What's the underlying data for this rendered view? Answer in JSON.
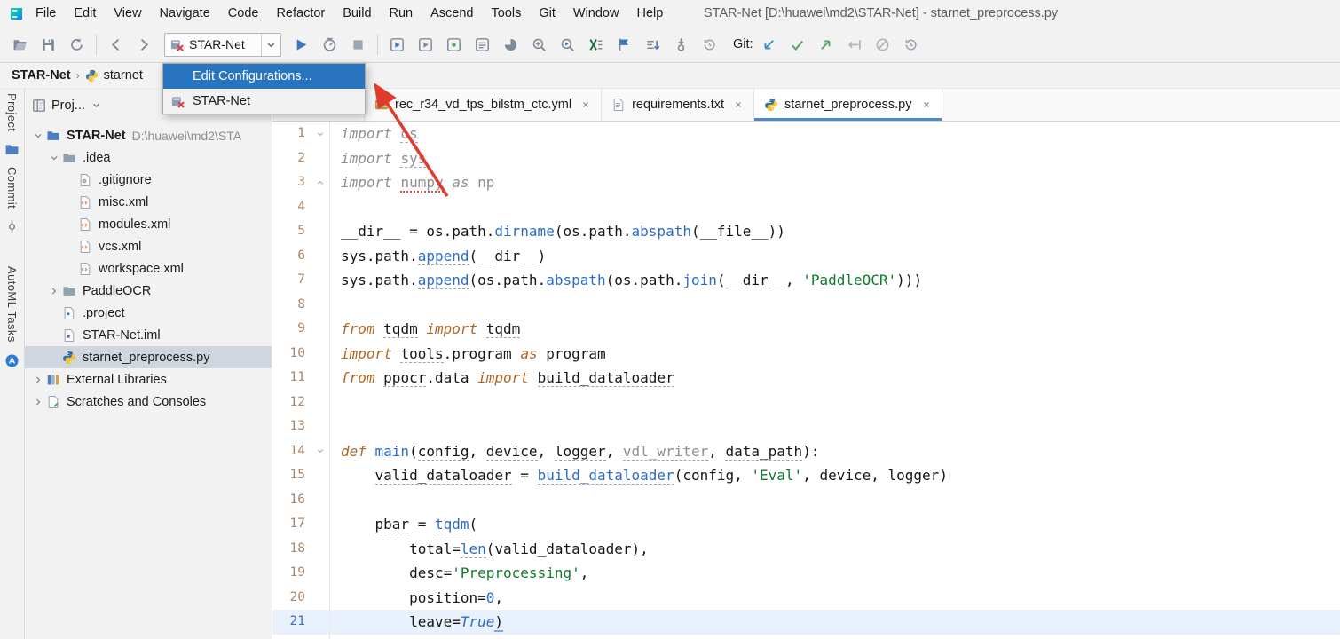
{
  "window": {
    "title": "STAR-Net [D:\\huawei\\md2\\STAR-Net] - starnet_preprocess.py",
    "app_icon": "app-logo"
  },
  "menu": {
    "items": [
      "File",
      "Edit",
      "View",
      "Navigate",
      "Code",
      "Refactor",
      "Build",
      "Run",
      "Ascend",
      "Tools",
      "Git",
      "Window",
      "Help"
    ]
  },
  "toolbar": {
    "file_icons": [
      {
        "name": "open-icon",
        "icon": "folder-open"
      },
      {
        "name": "save-all-icon",
        "icon": "save"
      },
      {
        "name": "sync-icon",
        "icon": "sync"
      }
    ],
    "nav_icons": [
      {
        "name": "back-icon",
        "icon": "back"
      },
      {
        "name": "forward-icon",
        "icon": "forward"
      }
    ],
    "run_config": {
      "label": "STAR-Net",
      "icon": "run-config-broken",
      "chevron": "chev-down"
    },
    "run_icons": [
      {
        "name": "run-button",
        "icon": "play"
      },
      {
        "name": "profiler-button",
        "icon": "profiler"
      },
      {
        "name": "stop-button",
        "icon": "stop"
      }
    ],
    "tool_icons": [
      {
        "name": "run-dashboard-icon",
        "icon": "sq-play"
      },
      {
        "name": "debug-dashboard-icon",
        "icon": "sq-play-gray"
      },
      {
        "name": "services-icon",
        "icon": "sq-dot"
      },
      {
        "name": "console-icon",
        "icon": "sq-lines"
      },
      {
        "name": "coverage-icon",
        "icon": "pie"
      },
      {
        "name": "inspect-code-icon",
        "icon": "search-plus"
      },
      {
        "name": "run-inspection-icon",
        "icon": "search-play"
      },
      {
        "name": "excel-export-icon",
        "icon": "excel"
      },
      {
        "name": "bookmark-icon",
        "icon": "flag"
      },
      {
        "name": "sort-lines-icon",
        "icon": "sort-lines"
      },
      {
        "name": "fetch-icon",
        "icon": "commit-down"
      },
      {
        "name": "local-history-icon",
        "icon": "history"
      }
    ],
    "git_label": "Git:",
    "git_icons": [
      {
        "name": "git-update-icon",
        "icon": "git-update"
      },
      {
        "name": "git-commit-icon",
        "icon": "git-check"
      },
      {
        "name": "git-push-icon",
        "icon": "git-push"
      },
      {
        "name": "git-revert-icon",
        "icon": "git-revert"
      },
      {
        "name": "git-stash-icon",
        "icon": "slash-circle"
      },
      {
        "name": "git-history-icon",
        "icon": "history"
      }
    ]
  },
  "breadcrumb": {
    "items": [
      {
        "label": "STAR-Net",
        "icon": null
      },
      {
        "label": "starnet",
        "icon": "python"
      }
    ]
  },
  "config_menu": {
    "items": [
      {
        "label": "Edit Configurations...",
        "selected": true,
        "icon": null
      },
      {
        "label": "STAR-Net",
        "selected": false,
        "icon": "run-config-broken"
      }
    ]
  },
  "stripe": {
    "items": [
      {
        "type": "label",
        "text": "Project",
        "name": "tool-button-project"
      },
      {
        "type": "icon",
        "icon": "folder-blue",
        "name": "project-tool-icon"
      },
      {
        "type": "label",
        "text": "Commit",
        "name": "tool-button-commit"
      },
      {
        "type": "icon",
        "icon": "stripe-commit",
        "name": "commit-tool-icon"
      },
      {
        "type": "gap",
        "size": 14
      },
      {
        "type": "label",
        "text": "AutoML Tasks",
        "name": "tool-button-automl-tasks"
      },
      {
        "type": "icon",
        "icon": "automl",
        "name": "automl-tool-icon"
      }
    ]
  },
  "project_panel": {
    "title": "Proj...",
    "header_icons": [
      {
        "name": "locate-file-icon",
        "icon": "target"
      },
      {
        "name": "settings-icon",
        "icon": "gear"
      }
    ],
    "tree": [
      {
        "label": "STAR-Net",
        "sublabel": "D:\\huawei\\md2\\STA",
        "depth": 0,
        "icon": "folder-blue",
        "chevron": "open",
        "bold": true
      },
      {
        "label": ".idea",
        "depth": 1,
        "icon": "folder",
        "chevron": "open"
      },
      {
        "label": ".gitignore",
        "depth": 2,
        "icon": "file-ignore"
      },
      {
        "label": "misc.xml",
        "depth": 2,
        "icon": "file-xml"
      },
      {
        "label": "modules.xml",
        "depth": 2,
        "icon": "file-xml"
      },
      {
        "label": "vcs.xml",
        "depth": 2,
        "icon": "file-xml"
      },
      {
        "label": "workspace.xml",
        "depth": 2,
        "icon": "file-xml"
      },
      {
        "label": "PaddleOCR",
        "depth": 1,
        "icon": "folder",
        "chevron": "closed"
      },
      {
        "label": ".project",
        "depth": 1,
        "icon": "file-project"
      },
      {
        "label": "STAR-Net.iml",
        "depth": 1,
        "icon": "file-iml"
      },
      {
        "label": "starnet_preprocess.py",
        "depth": 1,
        "icon": "python",
        "selected": true
      },
      {
        "label": "External Libraries",
        "depth": 0,
        "icon": "libraries",
        "chevron": "closed"
      },
      {
        "label": "Scratches and Consoles",
        "depth": 0,
        "icon": "scratches",
        "chevron": "closed"
      }
    ]
  },
  "tabs": [
    {
      "label": "",
      "icon": null,
      "stub": true
    },
    {
      "label": "rec_r34_vd_tps_bilstm_ctc.yml",
      "icon": "yml"
    },
    {
      "label": "requirements.txt",
      "icon": "file-text"
    },
    {
      "label": "starnet_preprocess.py",
      "icon": "python",
      "active": true
    }
  ],
  "editor": {
    "current_line": 21,
    "lines": [
      {
        "n": 1,
        "fold": "down",
        "segs": [
          {
            "t": "import ",
            "c": "gkw"
          },
          {
            "t": "os",
            "c": "gray",
            "u": "dash"
          }
        ]
      },
      {
        "n": 2,
        "segs": [
          {
            "t": "import ",
            "c": "gkw"
          },
          {
            "t": "sys",
            "c": "gray",
            "u": "dash"
          }
        ]
      },
      {
        "n": 3,
        "fold": "up",
        "segs": [
          {
            "t": "import ",
            "c": "gkw"
          },
          {
            "t": "numpy",
            "c": "gray",
            "u": "red"
          },
          {
            "t": " ",
            "c": "gray"
          },
          {
            "t": "as",
            "c": "gkw"
          },
          {
            "t": " np",
            "c": "gray"
          }
        ]
      },
      {
        "n": 4,
        "segs": []
      },
      {
        "n": 5,
        "segs": [
          {
            "t": "__dir__ = os.path.",
            "c": "plain"
          },
          {
            "t": "dirname",
            "c": "fn"
          },
          {
            "t": "(os.path.",
            "c": "plain"
          },
          {
            "t": "abspath",
            "c": "fn"
          },
          {
            "t": "(__file__))",
            "c": "plain"
          }
        ]
      },
      {
        "n": 6,
        "segs": [
          {
            "t": "sys.path.",
            "c": "plain"
          },
          {
            "t": "append",
            "c": "fn",
            "u": "dash"
          },
          {
            "t": "(__dir__)",
            "c": "plain"
          }
        ]
      },
      {
        "n": 7,
        "segs": [
          {
            "t": "sys.path.",
            "c": "plain"
          },
          {
            "t": "append",
            "c": "fn",
            "u": "dash"
          },
          {
            "t": "(os.path.",
            "c": "plain"
          },
          {
            "t": "abspath",
            "c": "fn"
          },
          {
            "t": "(os.path.",
            "c": "plain"
          },
          {
            "t": "join",
            "c": "fn"
          },
          {
            "t": "(__dir__, ",
            "c": "plain"
          },
          {
            "t": "'PaddleOCR'",
            "c": "str"
          },
          {
            "t": ")))",
            "c": "plain"
          }
        ]
      },
      {
        "n": 8,
        "segs": []
      },
      {
        "n": 9,
        "segs": [
          {
            "t": "from ",
            "c": "kw"
          },
          {
            "t": "tqdm",
            "c": "plain",
            "u": "dash"
          },
          {
            "t": " ",
            "c": "plain"
          },
          {
            "t": "import ",
            "c": "kw"
          },
          {
            "t": "tqdm",
            "c": "plain",
            "u": "dash"
          }
        ]
      },
      {
        "n": 10,
        "segs": [
          {
            "t": "import ",
            "c": "kw"
          },
          {
            "t": "tools",
            "c": "plain",
            "u": "dash"
          },
          {
            "t": ".program ",
            "c": "plain"
          },
          {
            "t": "as",
            "c": "kw"
          },
          {
            "t": " program",
            "c": "plain"
          }
        ]
      },
      {
        "n": 11,
        "segs": [
          {
            "t": "from ",
            "c": "kw"
          },
          {
            "t": "ppocr",
            "c": "plain",
            "u": "dash"
          },
          {
            "t": ".data ",
            "c": "plain"
          },
          {
            "t": "import ",
            "c": "kw"
          },
          {
            "t": "build_dataloader",
            "c": "plain",
            "u": "dash"
          }
        ]
      },
      {
        "n": 12,
        "segs": []
      },
      {
        "n": 13,
        "segs": []
      },
      {
        "n": 14,
        "fold": "down",
        "segs": [
          {
            "t": "def ",
            "c": "kw"
          },
          {
            "t": "main",
            "c": "fn"
          },
          {
            "t": "(",
            "c": "plain"
          },
          {
            "t": "config",
            "c": "plain",
            "u": "dash"
          },
          {
            "t": ", ",
            "c": "plain"
          },
          {
            "t": "device",
            "c": "plain",
            "u": "dash"
          },
          {
            "t": ", ",
            "c": "plain"
          },
          {
            "t": "logger",
            "c": "plain",
            "u": "dash"
          },
          {
            "t": ", ",
            "c": "plain"
          },
          {
            "t": "vdl_writer",
            "c": "gray",
            "u": "dash"
          },
          {
            "t": ", ",
            "c": "plain"
          },
          {
            "t": "data_path",
            "c": "plain",
            "u": "dash"
          },
          {
            "t": "):",
            "c": "plain"
          }
        ]
      },
      {
        "n": 15,
        "segs": [
          {
            "t": "    ",
            "c": "plain"
          },
          {
            "t": "valid_dataloader",
            "c": "plain",
            "u": "dash"
          },
          {
            "t": " = ",
            "c": "plain"
          },
          {
            "t": "build_dataloader",
            "c": "fn",
            "u": "dash"
          },
          {
            "t": "(config, ",
            "c": "plain"
          },
          {
            "t": "'Eval'",
            "c": "str"
          },
          {
            "t": ", device, logger)",
            "c": "plain"
          }
        ]
      },
      {
        "n": 16,
        "segs": []
      },
      {
        "n": 17,
        "segs": [
          {
            "t": "    ",
            "c": "plain"
          },
          {
            "t": "pbar",
            "c": "plain",
            "u": "dash"
          },
          {
            "t": " = ",
            "c": "plain"
          },
          {
            "t": "tqdm",
            "c": "fn",
            "u": "dash"
          },
          {
            "t": "(",
            "c": "plain"
          }
        ]
      },
      {
        "n": 18,
        "segs": [
          {
            "t": "        total=",
            "c": "plain"
          },
          {
            "t": "len",
            "c": "fn",
            "u": "dash"
          },
          {
            "t": "(valid_dataloader),",
            "c": "plain"
          }
        ]
      },
      {
        "n": 19,
        "segs": [
          {
            "t": "        desc=",
            "c": "plain"
          },
          {
            "t": "'Preprocessing'",
            "c": "str"
          },
          {
            "t": ",",
            "c": "plain"
          }
        ]
      },
      {
        "n": 20,
        "segs": [
          {
            "t": "        position=",
            "c": "plain"
          },
          {
            "t": "0",
            "c": "num"
          },
          {
            "t": ",",
            "c": "plain"
          }
        ]
      },
      {
        "n": 21,
        "segs": [
          {
            "t": "        leave=",
            "c": "plain"
          },
          {
            "t": "True",
            "c": "kw2"
          },
          {
            "t": ")",
            "c": "plain",
            "u": "blue"
          }
        ]
      }
    ]
  },
  "colors": {
    "menu_selection": "#2874BE",
    "tree_selection": "#CFD6DD",
    "current_line": "#E9F1FC",
    "annotation_red": "#E23B2E",
    "accent_blue": "#4A8AC9"
  }
}
